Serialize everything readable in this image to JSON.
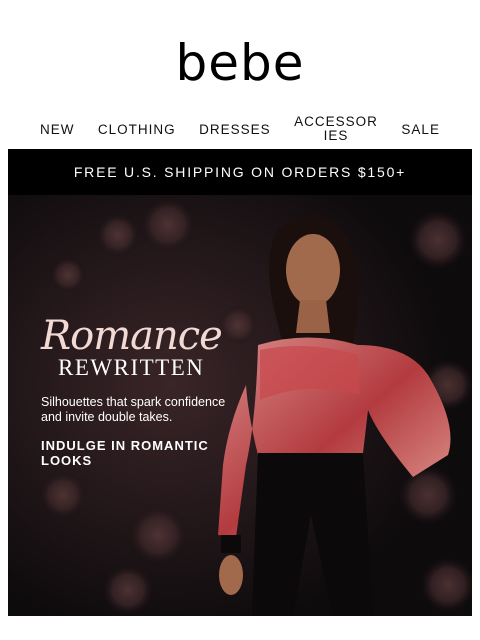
{
  "brand": {
    "logo_text": "bebe"
  },
  "nav": {
    "items": [
      "NEW",
      "CLOTHING",
      "DRESSES",
      "ACCESSORIES",
      "SALE"
    ]
  },
  "promo_bar": {
    "text": "FREE U.S. SHIPPING ON ORDERS $150+"
  },
  "hero": {
    "script_title": "Romance",
    "title": "REWRITTEN",
    "tagline": "Silhouettes that spark confidence and invite double takes.",
    "cta": "INDULGE IN ROMANTIC LOOKS"
  },
  "colors": {
    "bar_bg": "#000000",
    "hero_bg": "#141013",
    "script_color": "#f3d9d4"
  }
}
